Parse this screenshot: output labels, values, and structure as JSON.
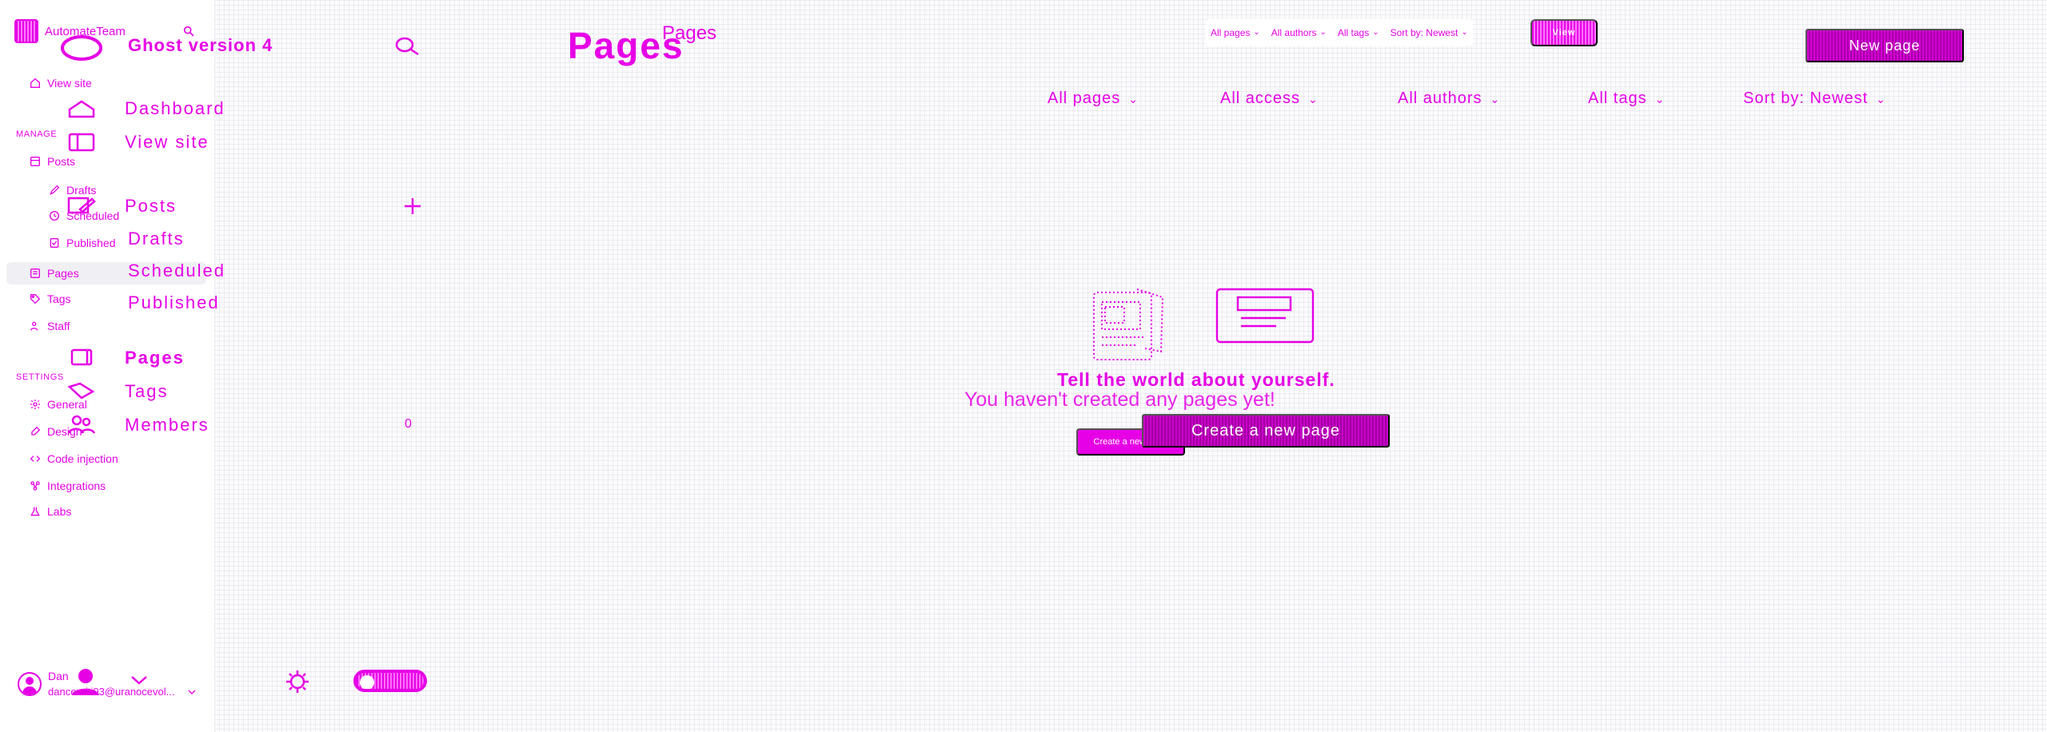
{
  "brand": {
    "name": "AutomateTeam",
    "overlay_title": "Ghost version 4"
  },
  "sidebar": {
    "small_nav": {
      "view_site": "View site",
      "manage_label": "MANAGE",
      "posts": "Posts",
      "drafts": "Drafts",
      "scheduled": "Scheduled",
      "published": "Published",
      "pages": "Pages",
      "tags": "Tags",
      "staff": "Staff",
      "settings_label": "SETTINGS",
      "general": "General",
      "design": "Design",
      "code_injection": "Code injection",
      "integrations": "Integrations",
      "labs": "Labs"
    },
    "large_nav": {
      "dashboard": "Dashboard",
      "view_site": "View site",
      "posts": "Posts",
      "drafts": "Drafts",
      "scheduled": "Scheduled",
      "published": "Published",
      "pages": "Pages",
      "tags": "Tags",
      "members": "Members",
      "members_count": "0"
    },
    "account": {
      "name": "Dan",
      "email": "danceruiti03@uranocevol..."
    }
  },
  "header": {
    "title_small": "Pages",
    "title_large": "Pages",
    "filters_small": [
      "All pages",
      "All authors",
      "All tags",
      "Sort by: Newest"
    ],
    "view_button": "View",
    "new_page_button": "New page",
    "filters_large": [
      "All pages",
      "All access",
      "All authors",
      "All tags",
      "Sort by: Newest"
    ]
  },
  "empty_state": {
    "title": "Tell the world about yourself.",
    "subtitle": "You haven't created any pages yet!",
    "button_small": "Create a new page",
    "button_large": "Create a new page"
  },
  "icons": {
    "brand": "brand-logo",
    "search": "search-icon",
    "ghost": "ghost-icon",
    "home": "home-icon",
    "document": "document-icon",
    "pencil": "pencil-icon",
    "clock": "clock-icon",
    "check": "check-icon",
    "page": "page-icon",
    "tag": "tag-icon",
    "user": "user-icon",
    "gear": "gear-icon",
    "brush": "brush-icon",
    "code": "code-icon",
    "integration": "integration-icon",
    "lab": "lab-icon",
    "chevron": "chevron-down-icon",
    "plus": "plus-icon",
    "people": "people-icon"
  },
  "colors": {
    "accent": "#e600e6",
    "background": "#fbfbfd",
    "sidebar_background": "#ffffff"
  }
}
